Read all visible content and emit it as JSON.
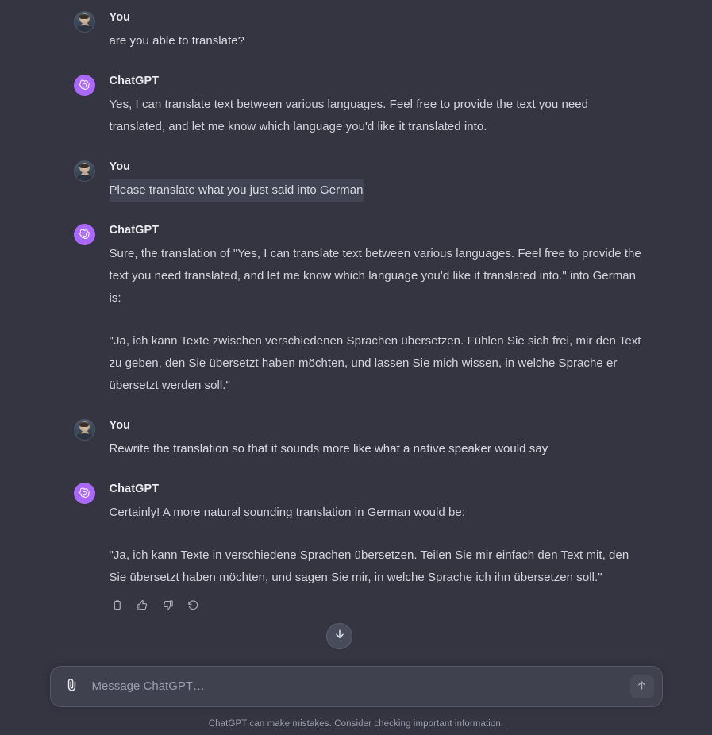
{
  "app": {
    "background_color": "#343541",
    "accent_color": "#ab68ff"
  },
  "conversation": {
    "messages": [
      {
        "author": "You",
        "avatar": "user-photo-avatar",
        "paragraphs": [
          "are you able to translate?"
        ]
      },
      {
        "author": "ChatGPT",
        "avatar": "openai-logo-avatar",
        "paragraphs": [
          "Yes, I can translate text between various languages. Feel free to provide the text you need translated, and let me know which language you'd like it translated into."
        ]
      },
      {
        "author": "You",
        "avatar": "user-photo-avatar",
        "paragraphs": [
          "Please translate what you just said into German"
        ]
      },
      {
        "author": "ChatGPT",
        "avatar": "openai-logo-avatar",
        "paragraphs": [
          "Sure, the translation of \"Yes, I can translate text between various languages. Feel free to provide the text you need translated, and let me know which language you'd like it translated into.\" into German is:",
          "\"Ja, ich kann Texte zwischen verschiedenen Sprachen übersetzen. Fühlen Sie sich frei, mir den Text zu geben, den Sie übersetzt haben möchten, und lassen Sie mich wissen, in welche Sprache er übersetzt werden soll.\""
        ]
      },
      {
        "author": "You",
        "avatar": "user-photo-avatar",
        "paragraphs": [
          "Rewrite the translation so that it sounds more like what a native speaker would say"
        ]
      },
      {
        "author": "ChatGPT",
        "avatar": "openai-logo-avatar",
        "paragraphs": [
          "Certainly! A more natural sounding translation in German would be:",
          "\"Ja, ich kann Texte in verschiedene Sprachen übersetzen. Teilen Sie mir einfach den Text mit, den Sie übersetzt haben möchten, und sagen Sie mir, in welche Sprache ich ihn übersetzen soll.\""
        ]
      }
    ]
  },
  "message_actions": {
    "copy": "copy-icon",
    "thumbs_up": "thumbs-up-icon",
    "thumbs_down": "thumbs-down-icon",
    "regenerate": "regenerate-icon"
  },
  "scroll_button": {
    "icon": "arrow-down-icon"
  },
  "composer": {
    "attach_icon": "paperclip-icon",
    "placeholder": "Message ChatGPT…",
    "value": "",
    "send_icon": "arrow-up-icon"
  },
  "footer": {
    "disclaimer": "ChatGPT can make mistakes. Consider checking important information."
  }
}
